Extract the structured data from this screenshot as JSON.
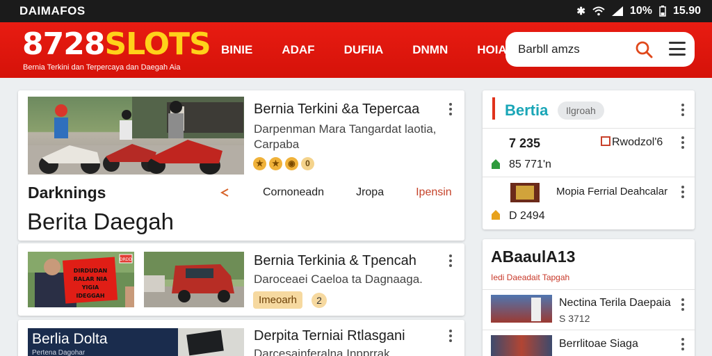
{
  "status": {
    "carrier": "DAIMAFOS",
    "battery": "10%",
    "time": "15.90"
  },
  "header": {
    "logo_main": "8728",
    "logo_accent": "SLOTS",
    "tagline": "Bernia Terkini dan Terpercaya dan Daegah Aia",
    "nav": [
      "BINIE",
      "ADAF",
      "DUFIIA",
      "DNMN",
      "HOIAT"
    ],
    "search_value": "Barbll amzs"
  },
  "featured": {
    "title": "Bernia Terkini &a Tepercaa",
    "subtitle_line1": "Darpenman Mara Tangardat laotia,",
    "subtitle_line2": "Carpaba",
    "rating_badge": "0"
  },
  "section": {
    "head": "Darknings",
    "tabs": [
      "Cornoneadn",
      "Jropa",
      "Ipensin"
    ],
    "big_title": "Berita Daegah"
  },
  "articles": [
    {
      "title": "Bernia Terkinia & Tpencah",
      "subtitle": "Daroceaei Caeloa ta Dagnaaga.",
      "pill": "Imeoarh",
      "count": "2",
      "sign_top": "DRDD",
      "sign_text": "DIRDUDAN RALAR NIA YIGIA IDEGGAH"
    },
    {
      "title": "Derpita Terniai Rtlasgani",
      "subtitle": "Darcesainferalna Inpprrak",
      "thumb_text": "Berlia Dolta",
      "thumb_sub": "Pertena Dagohar"
    }
  ],
  "right": {
    "card1": {
      "title": "Bertia",
      "tag": "Ilgroah",
      "rows": [
        {
          "left": "7 235",
          "right": "Rwodzol'6"
        },
        {
          "left": "85 771'n"
        },
        {
          "left": "Mopia Ferrial Deahcalar"
        },
        {
          "left": "D 2494"
        }
      ]
    },
    "card2": {
      "title": "ABaaulA13",
      "subtitle": "Iedi Daeadait Tapgah",
      "items": [
        {
          "title": "Nectina Terila Daepaia",
          "meta": "S 3712"
        },
        {
          "title": "Berrlitoae Siaga"
        }
      ]
    }
  },
  "colors": {
    "brand_red": "#e3170f",
    "logo_yellow": "#ffd21a",
    "accent_teal": "#1aa6b7"
  }
}
